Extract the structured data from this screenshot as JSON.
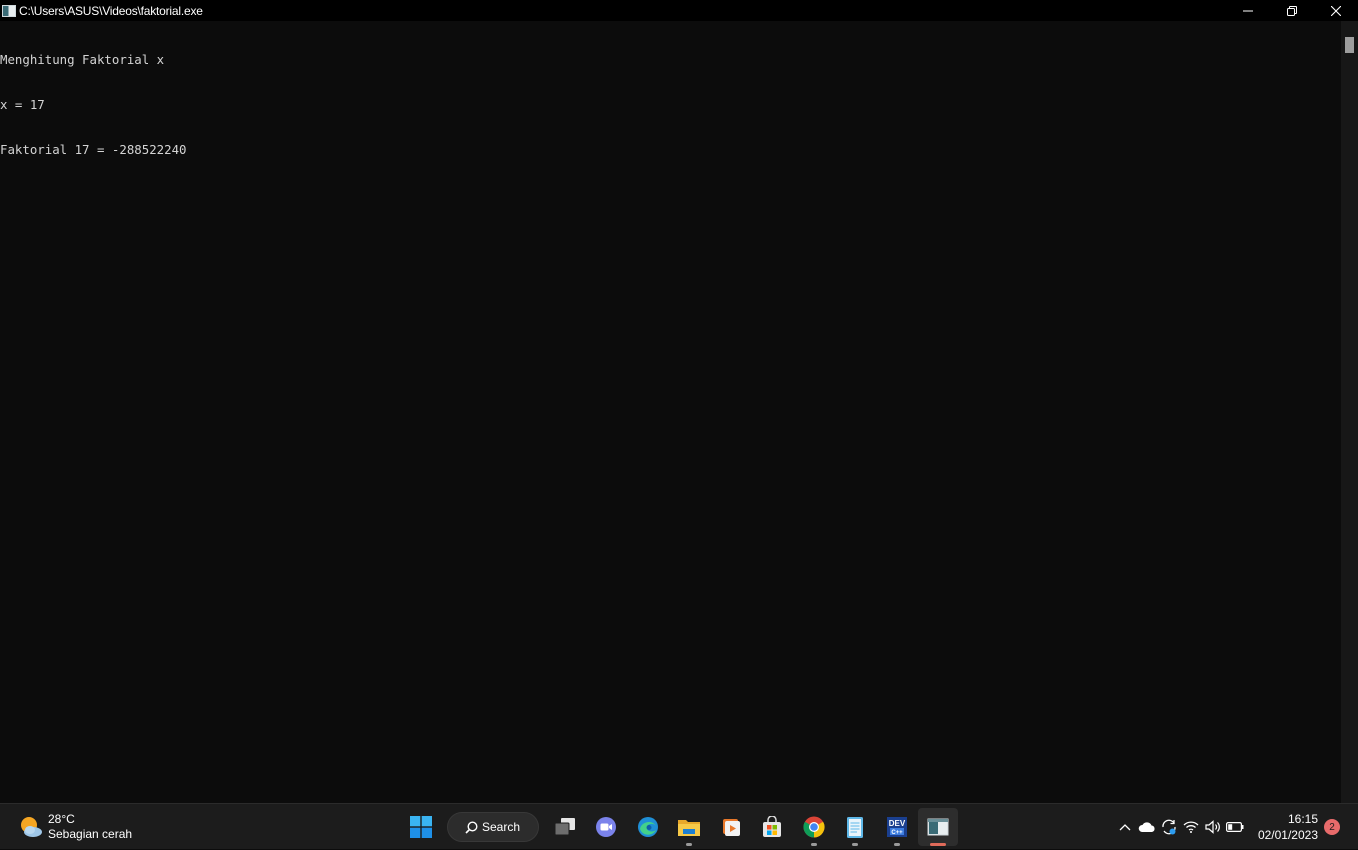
{
  "window": {
    "title": "C:\\Users\\ASUS\\Videos\\faktorial.exe"
  },
  "console": {
    "lines": [
      "Menghitung Faktorial x",
      "x = 17",
      "Faktorial 17 = -288522240"
    ]
  },
  "taskbar": {
    "weather": {
      "temp": "28°C",
      "desc": "Sebagian cerah",
      "icon": "partly-sunny-icon"
    },
    "search_label": "Search",
    "apps": [
      {
        "name": "start-menu",
        "icon": "windows-logo-icon"
      },
      {
        "name": "task-view",
        "icon": "task-view-icon"
      },
      {
        "name": "teams-chat",
        "icon": "video-chat-icon"
      },
      {
        "name": "edge",
        "icon": "edge-browser-icon"
      },
      {
        "name": "file-explorer",
        "icon": "folder-icon"
      },
      {
        "name": "media-player",
        "icon": "media-player-icon"
      },
      {
        "name": "microsoft-store",
        "icon": "store-icon"
      },
      {
        "name": "chrome",
        "icon": "chrome-icon"
      },
      {
        "name": "notepad",
        "icon": "notepad-icon"
      },
      {
        "name": "dev-cpp",
        "icon": "dev-cpp-icon",
        "label": "DEV"
      },
      {
        "name": "console-window",
        "icon": "console-icon"
      }
    ],
    "clock": {
      "time": "16:15",
      "date": "02/01/2023"
    },
    "notification_count": "2"
  },
  "colors": {
    "console_bg": "#0c0c0c",
    "titlebar_bg": "#000000",
    "taskbar_bg": "#1c1c1c",
    "active_indicator": "#e06b5a",
    "notification_badge": "#e86b6b"
  }
}
